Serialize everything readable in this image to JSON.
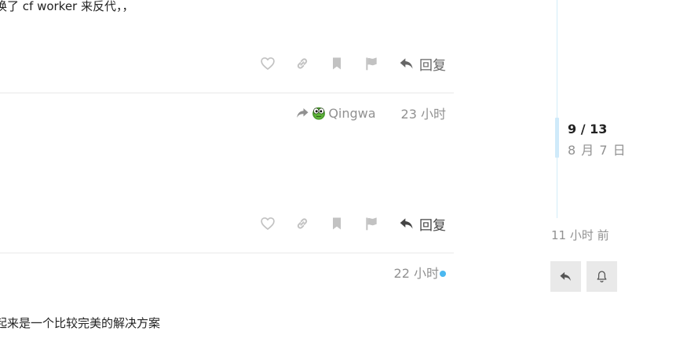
{
  "post1": {
    "text": "换了 cf worker 来反代，，"
  },
  "post2": {
    "reply_to_user": "Qingwa",
    "date": "23 小时"
  },
  "post3": {
    "date": "22 小时",
    "text": "起来是一个比较完美的解决方案"
  },
  "actions": {
    "reply_label": "回复",
    "like_icon": "heart-icon",
    "link_icon": "link-icon",
    "bookmark_icon": "bookmark-icon",
    "flag_icon": "flag-icon",
    "reply_icon": "reply-icon"
  },
  "timeline": {
    "counter": "9 / 13",
    "date": "8 月 7 日",
    "end_label": "11 小时 前",
    "reply_icon": "reply-icon",
    "notify_icon": "bell-icon"
  },
  "colors": {
    "icon_gray": "#c2c2c2",
    "meta_gray": "#919191",
    "timeline_blue": "#cfeafa",
    "unread_dot": "#4bb8f0",
    "button_bg": "#e9e9e9"
  }
}
